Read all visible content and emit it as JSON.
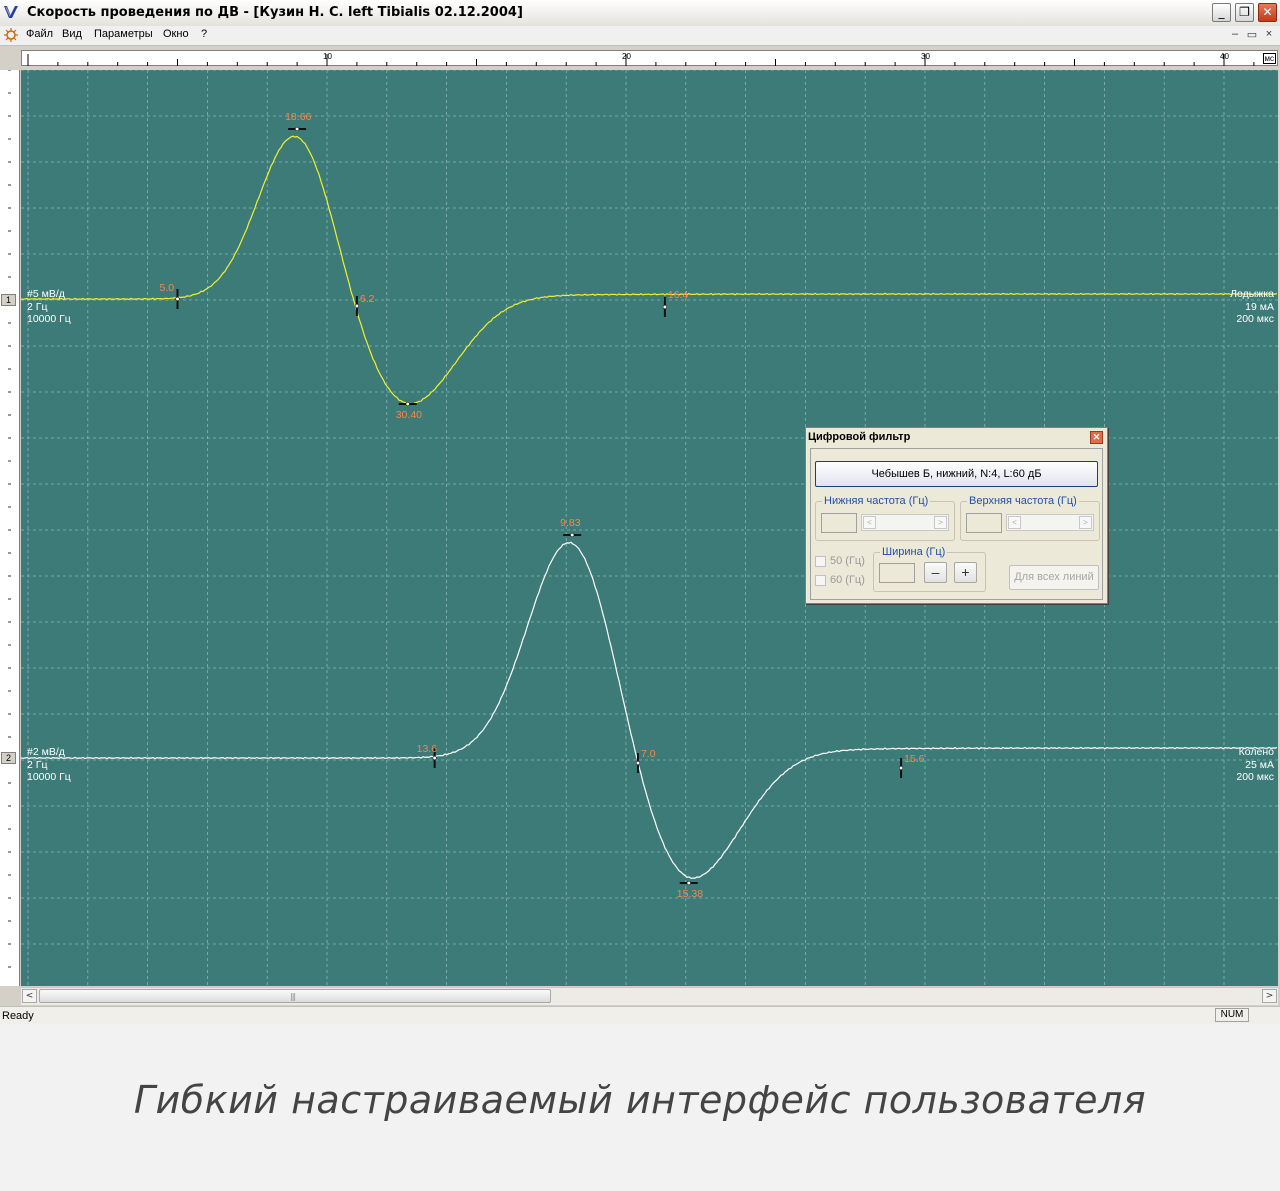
{
  "window": {
    "title": "Скорость проведения по ДВ - [Кузин Н. С. left Tibialis 02.12.2004]",
    "buttons": {
      "minimize": "_",
      "restore": "❐",
      "close": "✕"
    }
  },
  "menu": {
    "items": [
      "Файл",
      "Вид",
      "Параметры",
      "Окно",
      "?"
    ],
    "mdi": {
      "minimize": "–",
      "restore": "🗗",
      "close": "×"
    }
  },
  "ruler": {
    "labels": [
      "10",
      "20",
      "30",
      "40"
    ],
    "unit": "мс"
  },
  "channels": [
    {
      "index": "1",
      "color": "#f2f226",
      "left_info": [
        "#5 мВ/д",
        "2 Гц",
        "10000 Гц"
      ],
      "right_info": [
        "Лодыжка",
        "19 мА",
        "200 мкс"
      ],
      "markers": [
        {
          "label": "5.0",
          "t_ms": 5.0
        },
        {
          "label": "18.66",
          "t_ms": 9.0
        },
        {
          "label": "6.2",
          "t_ms": 11.0
        },
        {
          "label": "30.40",
          "t_ms": 12.7
        },
        {
          "label": "16.4",
          "t_ms": 21.3
        }
      ]
    },
    {
      "index": "2",
      "color": "#ffffff",
      "left_info": [
        "#2 мВ/д",
        "2 Гц",
        "10000 Гц"
      ],
      "right_info": [
        "Колено",
        "25 мА",
        "200 мкс"
      ],
      "markers": [
        {
          "label": "13.6",
          "t_ms": 13.6
        },
        {
          "label": "9.83",
          "t_ms": 18.2
        },
        {
          "label": "7.0",
          "t_ms": 20.4
        },
        {
          "label": "15.38",
          "t_ms": 22.1
        },
        {
          "label": "15.6",
          "t_ms": 29.2
        }
      ]
    }
  ],
  "dialog": {
    "title": "Цифровой фильтр",
    "filter_button": "Чебышев Б, нижний, N:4, L:60 дБ",
    "low_freq_label": "Нижняя частота (Гц)",
    "high_freq_label": "Верхняя частота (Гц)",
    "check_50": "50 (Гц)",
    "check_60": "60 (Гц)",
    "width_label": "Ширина (Гц)",
    "minus": "–",
    "plus": "+",
    "all_lines_button": "Для всех линий",
    "scroll_left": "<",
    "scroll_right": ">"
  },
  "scrollbar": {
    "left": "<",
    "right": ">",
    "grip": "|||"
  },
  "status": {
    "text": "Ready",
    "num": "NUM"
  },
  "caption": "Гибкий настраиваемый интерфейс пользователя",
  "colors": {
    "plot_bg": "#3d7b78",
    "marker_label": "#f08a4a",
    "grid": "#8ab6b3"
  }
}
